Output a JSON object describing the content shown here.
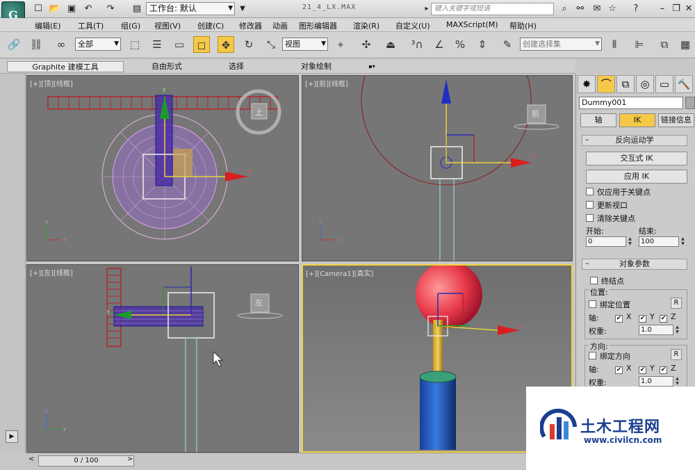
{
  "titlebar": {
    "logo": "G",
    "workspace_label": "工作台: 默认",
    "doc_title": "21_4_LX.MAX",
    "search_placeholder": "键入关键字或短语"
  },
  "menu": [
    "编辑(E)",
    "工具(T)",
    "组(G)",
    "视图(V)",
    "创建(C)",
    "修改器",
    "动画",
    "图形编辑器",
    "渲染(R)",
    "自定义(U)",
    "MAXScript(M)",
    "帮助(H)"
  ],
  "toolbar": {
    "filter_value": "全部",
    "view_value": "视图",
    "selection_set_placeholder": "创建选择集"
  },
  "ribbon": {
    "tabs": [
      "Graphite 建模工具",
      "自由形式",
      "选择",
      "对象绘制"
    ]
  },
  "viewports": {
    "top": "[+][顶][线框]",
    "front": "[+][前][线框]",
    "left": "[+][左][线框]",
    "camera": "[+][Camera1][真实]",
    "cube_top": "上",
    "cube_front": "前",
    "cube_left": "左"
  },
  "panel": {
    "object_name": "Dummy001",
    "tabs": [
      "轴",
      "IK",
      "链接信息"
    ],
    "ik_rollout": {
      "title": "反向运动学",
      "interactive_ik": "交互式 IK",
      "apply_ik": "应用 IK",
      "keys_only": "仅应用于关键点",
      "update_viewports": "更新视口",
      "clear_keys": "清除关键点",
      "start_label": "开始:",
      "end_label": "结束:",
      "start_value": "0",
      "end_value": "100"
    },
    "object_params": {
      "title": "对象参数",
      "terminator": "终结点",
      "position_label": "位置:",
      "bind_position": "绑定位置",
      "axis_label": "轴:",
      "x": "X",
      "y": "Y",
      "z": "Z",
      "weight_label": "权重:",
      "weight_value": "1.0",
      "orientation_label": "方向:",
      "bind_orientation": "绑定方向",
      "weight_value_2": "1.0",
      "r": "R"
    }
  },
  "timeline": {
    "frame": "0 / 100"
  },
  "watermark": {
    "title": "土木工程网",
    "url": "www.civilcn.com"
  },
  "colors": {
    "accent": "#f5c84a",
    "viewport_bg": "#767676",
    "watermark_blue": "#1b3f8f"
  }
}
